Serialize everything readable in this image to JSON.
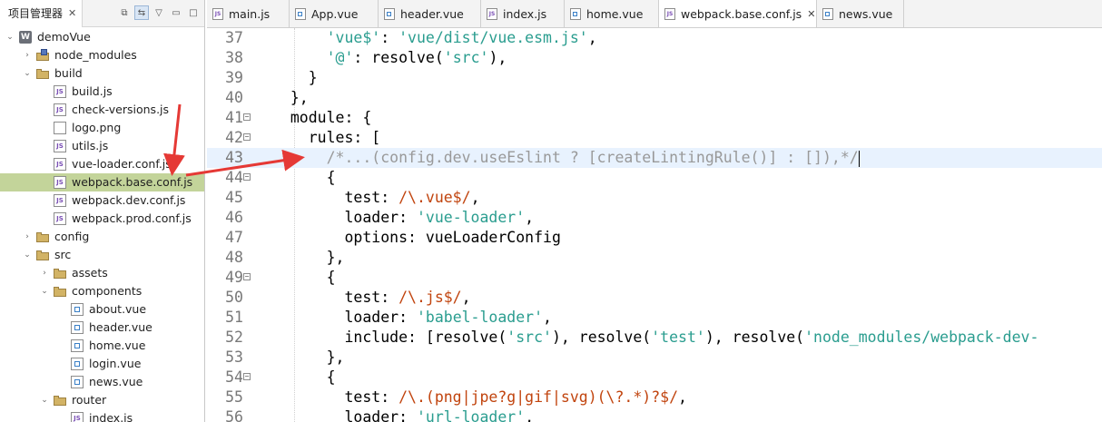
{
  "explorer": {
    "title": "项目管理器",
    "tree": [
      {
        "label": "demoVue",
        "level": 0,
        "icon": "project",
        "twisty": "open"
      },
      {
        "label": "node_modules",
        "level": 1,
        "icon": "nm",
        "twisty": "closed"
      },
      {
        "label": "build",
        "level": 1,
        "icon": "folder",
        "twisty": "open"
      },
      {
        "label": "build.js",
        "level": 2,
        "icon": "js"
      },
      {
        "label": "check-versions.js",
        "level": 2,
        "icon": "js"
      },
      {
        "label": "logo.png",
        "level": 2,
        "icon": "png"
      },
      {
        "label": "utils.js",
        "level": 2,
        "icon": "js"
      },
      {
        "label": "vue-loader.conf.js",
        "level": 2,
        "icon": "js"
      },
      {
        "label": "webpack.base.conf.js",
        "level": 2,
        "icon": "js",
        "selected": true
      },
      {
        "label": "webpack.dev.conf.js",
        "level": 2,
        "icon": "js"
      },
      {
        "label": "webpack.prod.conf.js",
        "level": 2,
        "icon": "js"
      },
      {
        "label": "config",
        "level": 1,
        "icon": "folder",
        "twisty": "closed"
      },
      {
        "label": "src",
        "level": 1,
        "icon": "folder",
        "twisty": "open"
      },
      {
        "label": "assets",
        "level": 2,
        "icon": "folder",
        "twisty": "closed"
      },
      {
        "label": "components",
        "level": 2,
        "icon": "folder",
        "twisty": "open"
      },
      {
        "label": "about.vue",
        "level": 3,
        "icon": "vue"
      },
      {
        "label": "header.vue",
        "level": 3,
        "icon": "vue"
      },
      {
        "label": "home.vue",
        "level": 3,
        "icon": "vue"
      },
      {
        "label": "login.vue",
        "level": 3,
        "icon": "vue"
      },
      {
        "label": "news.vue",
        "level": 3,
        "icon": "vue"
      },
      {
        "label": "router",
        "level": 2,
        "icon": "folder",
        "twisty": "open"
      },
      {
        "label": "index.js",
        "level": 3,
        "icon": "js"
      }
    ]
  },
  "tabs": [
    {
      "label": "main.js",
      "type": "js",
      "width": 91
    },
    {
      "label": "App.vue",
      "type": "vue",
      "width": 98
    },
    {
      "label": "header.vue",
      "type": "vue",
      "width": 113
    },
    {
      "label": "index.js",
      "type": "js",
      "width": 92
    },
    {
      "label": "home.vue",
      "type": "vue",
      "width": 104
    },
    {
      "label": "webpack.base.conf.js",
      "type": "js",
      "width": 174,
      "active": true
    },
    {
      "label": "news.vue",
      "type": "vue",
      "width": 96
    }
  ],
  "editor": {
    "lines": [
      {
        "num": "37",
        "fold": false,
        "tokens": [
          {
            "t": "      "
          },
          {
            "t": "'vue$'",
            "c": "str"
          },
          {
            "t": ": "
          },
          {
            "t": "'vue/dist/vue.esm.js'",
            "c": "str"
          },
          {
            "t": ","
          }
        ]
      },
      {
        "num": "38",
        "fold": false,
        "tokens": [
          {
            "t": "      "
          },
          {
            "t": "'@'",
            "c": "str"
          },
          {
            "t": ": resolve("
          },
          {
            "t": "'src'",
            "c": "str"
          },
          {
            "t": "),"
          }
        ]
      },
      {
        "num": "39",
        "fold": false,
        "tokens": [
          {
            "t": "    }"
          }
        ]
      },
      {
        "num": "40",
        "fold": false,
        "tokens": [
          {
            "t": "  },"
          }
        ]
      },
      {
        "num": "41",
        "fold": true,
        "tokens": [
          {
            "t": "  module: {"
          }
        ]
      },
      {
        "num": "42",
        "fold": true,
        "tokens": [
          {
            "t": "    rules: ["
          }
        ]
      },
      {
        "num": "43",
        "fold": false,
        "highlight": true,
        "cursor": true,
        "tokens": [
          {
            "t": "      "
          },
          {
            "t": "/*...(config.dev.useEslint ? [createLintingRule()] : []),*/",
            "c": "comment"
          }
        ]
      },
      {
        "num": "44",
        "fold": true,
        "tokens": [
          {
            "t": "      {"
          }
        ]
      },
      {
        "num": "45",
        "fold": false,
        "tokens": [
          {
            "t": "        test: "
          },
          {
            "t": "/\\.vue$/",
            "c": "regex"
          },
          {
            "t": ","
          }
        ]
      },
      {
        "num": "46",
        "fold": false,
        "tokens": [
          {
            "t": "        loader: "
          },
          {
            "t": "'vue-loader'",
            "c": "str"
          },
          {
            "t": ","
          }
        ]
      },
      {
        "num": "47",
        "fold": false,
        "tokens": [
          {
            "t": "        options: vueLoaderConfig"
          }
        ]
      },
      {
        "num": "48",
        "fold": false,
        "tokens": [
          {
            "t": "      },"
          }
        ]
      },
      {
        "num": "49",
        "fold": true,
        "tokens": [
          {
            "t": "      {"
          }
        ]
      },
      {
        "num": "50",
        "fold": false,
        "tokens": [
          {
            "t": "        test: "
          },
          {
            "t": "/\\.js$/",
            "c": "regex"
          },
          {
            "t": ","
          }
        ]
      },
      {
        "num": "51",
        "fold": false,
        "tokens": [
          {
            "t": "        loader: "
          },
          {
            "t": "'babel-loader'",
            "c": "str"
          },
          {
            "t": ","
          }
        ]
      },
      {
        "num": "52",
        "fold": false,
        "tokens": [
          {
            "t": "        include: [resolve("
          },
          {
            "t": "'src'",
            "c": "str"
          },
          {
            "t": "), resolve("
          },
          {
            "t": "'test'",
            "c": "str"
          },
          {
            "t": "), resolve("
          },
          {
            "t": "'node_modules/webpack-dev-",
            "c": "str"
          }
        ]
      },
      {
        "num": "53",
        "fold": false,
        "tokens": [
          {
            "t": "      },"
          }
        ]
      },
      {
        "num": "54",
        "fold": true,
        "tokens": [
          {
            "t": "      {"
          }
        ]
      },
      {
        "num": "55",
        "fold": false,
        "tokens": [
          {
            "t": "        test: "
          },
          {
            "t": "/\\.(png|jpe?g|gif|svg)(\\?.*)?$/",
            "c": "regex"
          },
          {
            "t": ","
          }
        ]
      },
      {
        "num": "56",
        "fold": false,
        "tokens": [
          {
            "t": "        loader: "
          },
          {
            "t": "'url-loader'",
            "c": "str"
          },
          {
            "t": ","
          }
        ]
      }
    ]
  },
  "colors": {
    "selection": "#c3d49a",
    "highlight_line": "#e8f2fe",
    "string": "#2a9d8f",
    "regex": "#c1440e",
    "comment": "#999999",
    "arrow": "#e53935"
  }
}
